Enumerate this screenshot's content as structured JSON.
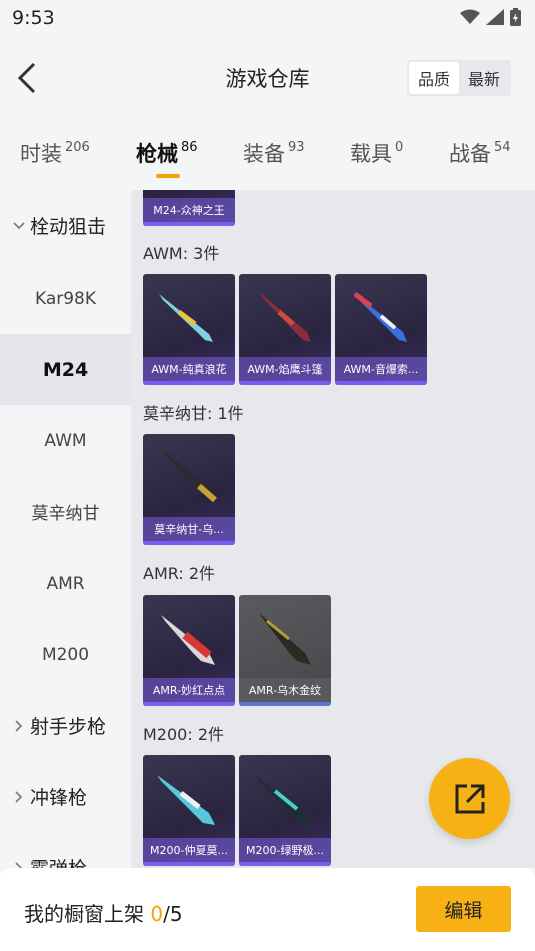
{
  "status": {
    "time": "9:53"
  },
  "header": {
    "title": "游戏仓库",
    "sort_options": [
      "品质",
      "最新"
    ]
  },
  "tabs": [
    {
      "label": "时装",
      "count": "206"
    },
    {
      "label": "枪械",
      "count": "86"
    },
    {
      "label": "装备",
      "count": "93"
    },
    {
      "label": "载具",
      "count": "0"
    },
    {
      "label": "战备",
      "count": "54"
    }
  ],
  "sidebar": {
    "category_open": "栓动狙击",
    "items": [
      "Kar98K",
      "M24",
      "AWM",
      "莫辛纳甘",
      "AMR",
      "M200"
    ],
    "categories_closed": [
      "射手步枪",
      "冲锋枪",
      "霰弹枪"
    ]
  },
  "content": {
    "partial_card": "M24-众神之王",
    "groups": [
      {
        "title": "AWM: 3件",
        "cards": [
          "AWM-纯真浪花",
          "AWM-焰鹰斗篷",
          "AWM-音爆索..."
        ]
      },
      {
        "title": "莫辛纳甘: 1件",
        "cards": [
          "莫辛纳甘-乌..."
        ]
      },
      {
        "title": "AMR: 2件",
        "cards": [
          "AMR-妙红点点",
          "AMR-乌木金纹"
        ]
      },
      {
        "title": "M200: 2件",
        "cards": [
          "M200-仲夏莫...",
          "M200-绿野极..."
        ]
      }
    ]
  },
  "bottom": {
    "label": "我的橱窗上架",
    "count_current": "0",
    "count_total": "/5",
    "edit_label": "编辑"
  },
  "colors": {
    "accent": "#f7b114",
    "card_purple": "#7b5cf0"
  }
}
